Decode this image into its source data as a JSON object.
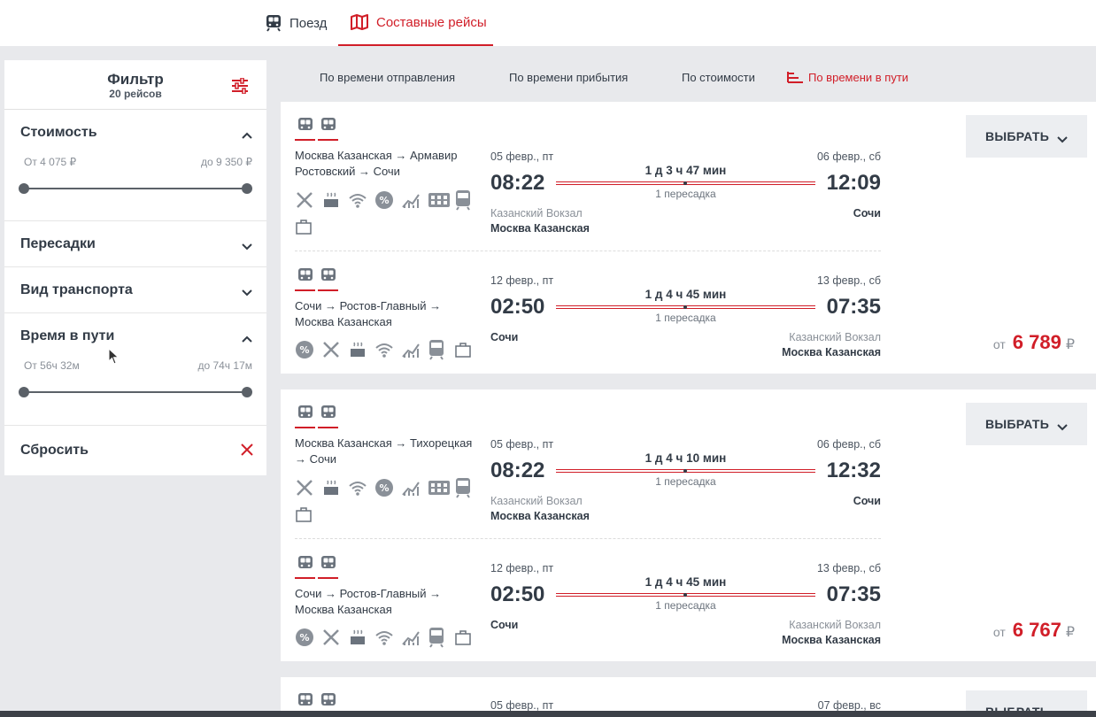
{
  "tabs": {
    "train": "Поезд",
    "composite": "Составные рейсы"
  },
  "filter": {
    "title": "Фильтр",
    "count": "20 рейсов",
    "cost": {
      "title": "Стоимость",
      "from": "От 4 075 ₽",
      "to": "до 9 350 ₽",
      "range": [
        0,
        1
      ]
    },
    "transfers": "Пересадки",
    "transport": "Вид транспорта",
    "duration": {
      "title": "Время в пути",
      "from": "От 56ч 32м",
      "to": "до 74ч 17м",
      "range": [
        0,
        1
      ]
    },
    "reset": "Сбросить"
  },
  "sort": {
    "departure": "По времени отправления",
    "arrival": "По времени прибытия",
    "cost": "По стоимости",
    "duration": "По времени в пути",
    "active": "duration"
  },
  "choose_label": "ВЫБРАТЬ",
  "price_prefix": "от",
  "currency": "₽",
  "cards": [
    {
      "price": "6 789",
      "legs": [
        {
          "route_1": "Москва Казанская → Армавир",
          "route_2": "Ростовский → Сочи",
          "dep_date": "05 февр., пт",
          "dep_time": "08:22",
          "arr_date": "06 февр., сб",
          "arr_time": "12:09",
          "duration": "1 д 3 ч 47 мин",
          "transfer": "1 пересадка",
          "dep_station": "Казанский Вокзал",
          "dep_city": "Москва Казанская",
          "arr_station": "",
          "arr_city": "Сочи"
        },
        {
          "route_1": "Сочи → Ростов-Главный →",
          "route_2": "Москва Казанская",
          "dep_date": "12 февр., пт",
          "dep_time": "02:50",
          "arr_date": "13 февр., сб",
          "arr_time": "07:35",
          "duration": "1 д 4 ч 45 мин",
          "transfer": "1 пересадка",
          "dep_station": "",
          "dep_city": "Сочи",
          "arr_station": "Казанский Вокзал",
          "arr_city": "Москва Казанская"
        }
      ]
    },
    {
      "price": "6 767",
      "legs": [
        {
          "route_1": "Москва Казанская → Тихорецкая",
          "route_2": "→ Сочи",
          "dep_date": "05 февр., пт",
          "dep_time": "08:22",
          "arr_date": "06 февр., сб",
          "arr_time": "12:32",
          "duration": "1 д 4 ч 10 мин",
          "transfer": "1 пересадка",
          "dep_station": "Казанский Вокзал",
          "dep_city": "Москва Казанская",
          "arr_station": "",
          "arr_city": "Сочи"
        },
        {
          "route_1": "Сочи → Ростов-Главный →",
          "route_2": "Москва Казанская",
          "dep_date": "12 февр., пт",
          "dep_time": "02:50",
          "arr_date": "13 февр., сб",
          "arr_time": "07:35",
          "duration": "1 д 4 ч 45 мин",
          "transfer": "1 пересадка",
          "dep_station": "",
          "dep_city": "Сочи",
          "arr_station": "Казанский Вокзал",
          "arr_city": "Москва Казанская"
        }
      ]
    },
    {
      "legs": [
        {
          "dep_date": "05 февр., пт",
          "arr_date": "07 февр., вс"
        }
      ]
    }
  ],
  "colors": {
    "accent": "#d11e28",
    "text": "#323b46",
    "background": "#e8e9ec"
  }
}
